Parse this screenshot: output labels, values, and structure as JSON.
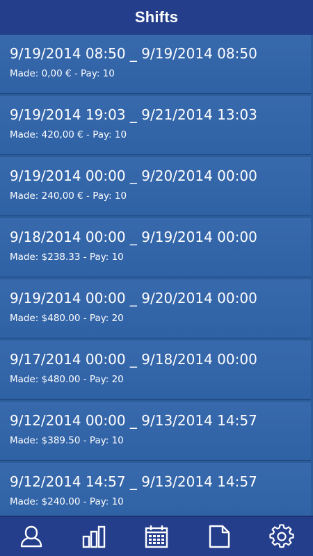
{
  "header": {
    "title": "Shifts"
  },
  "shifts": [
    {
      "range": "9/19/2014 08:50 _ 9/19/2014 08:50",
      "details": "Made: 0,00 € - Pay: 10"
    },
    {
      "range": "9/19/2014 19:03 _ 9/21/2014 13:03",
      "details": "Made: 420,00 € - Pay: 10"
    },
    {
      "range": "9/19/2014 00:00 _ 9/20/2014 00:00",
      "details": "Made: 240,00 € - Pay: 10"
    },
    {
      "range": "9/18/2014 00:00 _ 9/19/2014 00:00",
      "details": "Made: $238.33 - Pay: 10"
    },
    {
      "range": "9/19/2014 00:00 _ 9/20/2014 00:00",
      "details": "Made: $480.00 - Pay: 20"
    },
    {
      "range": "9/17/2014 00:00 _ 9/18/2014 00:00",
      "details": "Made: $480.00 - Pay: 20"
    },
    {
      "range": "9/12/2014 00:00 _ 9/13/2014 14:57",
      "details": "Made: $389.50 - Pay: 10"
    },
    {
      "range": "9/12/2014 14:57 _ 9/13/2014 14:57",
      "details": "Made: $240.00 - Pay: 10"
    }
  ],
  "tabs": [
    {
      "icon": "person-icon"
    },
    {
      "icon": "bar-chart-icon"
    },
    {
      "icon": "calendar-icon"
    },
    {
      "icon": "document-icon"
    },
    {
      "icon": "gear-icon"
    }
  ],
  "colors": {
    "header": "#243e8c",
    "row": "#3368aa",
    "text": "#ffffff"
  }
}
